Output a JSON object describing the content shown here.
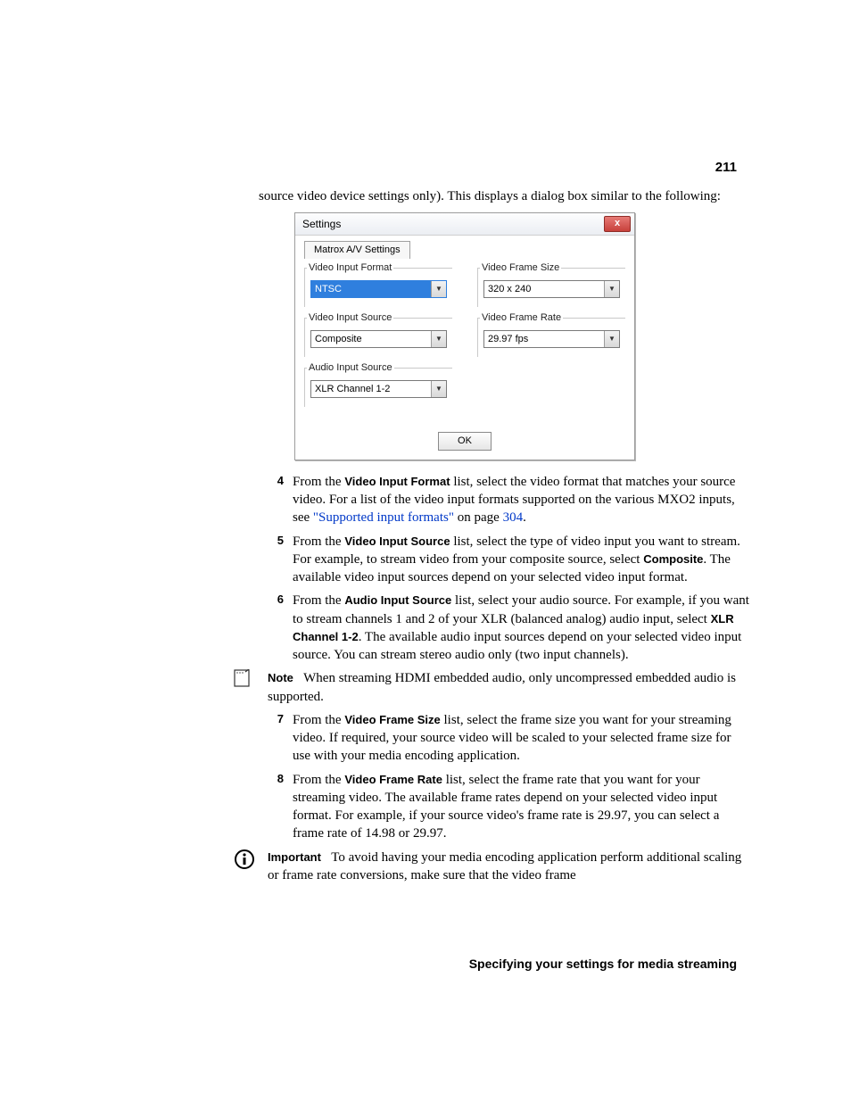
{
  "page_number": "211",
  "intro": "source video device settings only). This displays a dialog box similar to the following:",
  "dialog": {
    "title": "Settings",
    "tab": "Matrox A/V Settings",
    "video_input_format": {
      "legend": "Video Input Format",
      "value": "NTSC"
    },
    "video_input_source": {
      "legend": "Video Input Source",
      "value": "Composite"
    },
    "audio_input_source": {
      "legend": "Audio Input Source",
      "value": "XLR Channel 1-2"
    },
    "video_frame_size": {
      "legend": "Video Frame Size",
      "value": "320 x 240"
    },
    "video_frame_rate": {
      "legend": "Video Frame Rate",
      "value": "29.97 fps"
    },
    "ok": "OK",
    "close": "x"
  },
  "steps": {
    "s4": {
      "num": "4",
      "bold1": "Video Input Format",
      "text1": "From the ",
      "text2": " list, select the video format that matches your source video. For a list of the video input formats supported on the various MXO2 inputs, see ",
      "link_text": "\"Supported input formats\"",
      "link_after": " on page ",
      "page_link": "304",
      "link_end": "."
    },
    "s5": {
      "num": "5",
      "text1": "From the ",
      "bold1": "Video Input Source",
      "text2": " list, select the type of video input you want to stream. For example, to stream video from your composite source, select ",
      "bold2": "Composite",
      "text3": ". The available video input sources depend on your selected video input format."
    },
    "s6": {
      "num": "6",
      "text1": "From the ",
      "bold1": "Audio Input Source",
      "text2": " list, select your audio source. For example, if you want to stream channels 1 and 2 of your XLR (balanced analog) audio input, select ",
      "bold2": "XLR Channel 1-2",
      "text3": ". The available audio input sources depend on your selected video input source. You can stream stereo audio only (two input channels)."
    },
    "note": {
      "label": "Note",
      "text": "When streaming HDMI embedded audio, only uncompressed embedded audio is supported."
    },
    "s7": {
      "num": "7",
      "text1": "From the ",
      "bold1": "Video Frame Size",
      "text2": " list, select the frame size you want for your streaming video. If required, your source video will be scaled to your selected frame size for use with your media encoding application."
    },
    "s8": {
      "num": "8",
      "text1": "From the ",
      "bold1": "Video Frame Rate",
      "text2": " list, select the frame rate that you want for your streaming video. The available frame rates depend on your selected video input format. For example, if your source video's frame rate is 29.97, you can select a frame rate of 14.98 or 29.97."
    },
    "important": {
      "label": "Important",
      "text": "To avoid having your media encoding application perform additional scaling or frame rate conversions, make sure that the video frame"
    }
  },
  "footer": "Specifying your settings for media streaming"
}
